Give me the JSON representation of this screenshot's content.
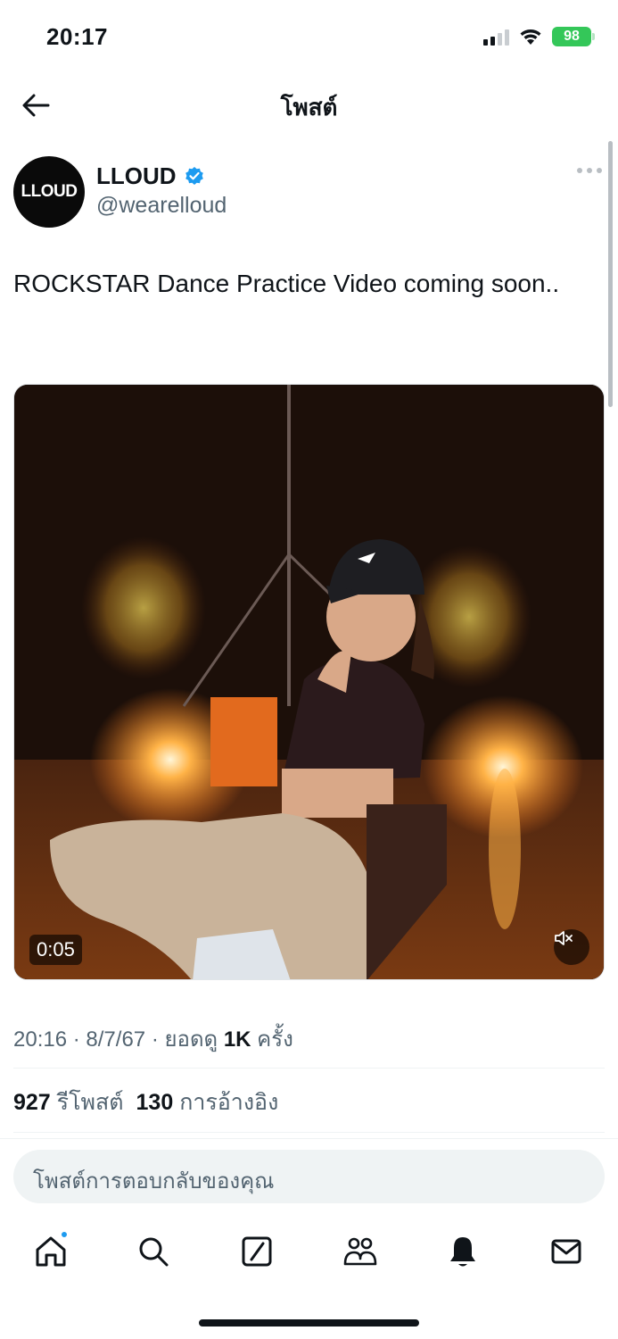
{
  "status_bar": {
    "time": "20:17",
    "battery": "98"
  },
  "header": {
    "title": "โพสต์"
  },
  "post": {
    "author_name": "LLOUD",
    "author_handle": "@wearelloud",
    "avatar_text": "LLOUD",
    "verified": true,
    "text": "ROCKSTAR Dance Practice Video coming soon..",
    "video_duration": "0:05",
    "time": "20:16",
    "date": "8/7/67",
    "views_label": "ยอดดู",
    "views_count": "1K",
    "views_suffix": "ครั้ง",
    "reposts_count": "927",
    "reposts_label": "รีโพสต์",
    "quotes_count": "130",
    "quotes_label": "การอ้างอิง"
  },
  "reply": {
    "placeholder": "โพสต์การตอบกลับของคุณ"
  },
  "colors": {
    "accent": "#1d9bf0",
    "text": "#0f1419",
    "secondary_text": "#536471",
    "battery": "#34c759"
  },
  "nav": {
    "items": [
      "home-icon",
      "search-icon",
      "grok-icon",
      "communities-icon",
      "notifications-icon",
      "messages-icon"
    ]
  }
}
